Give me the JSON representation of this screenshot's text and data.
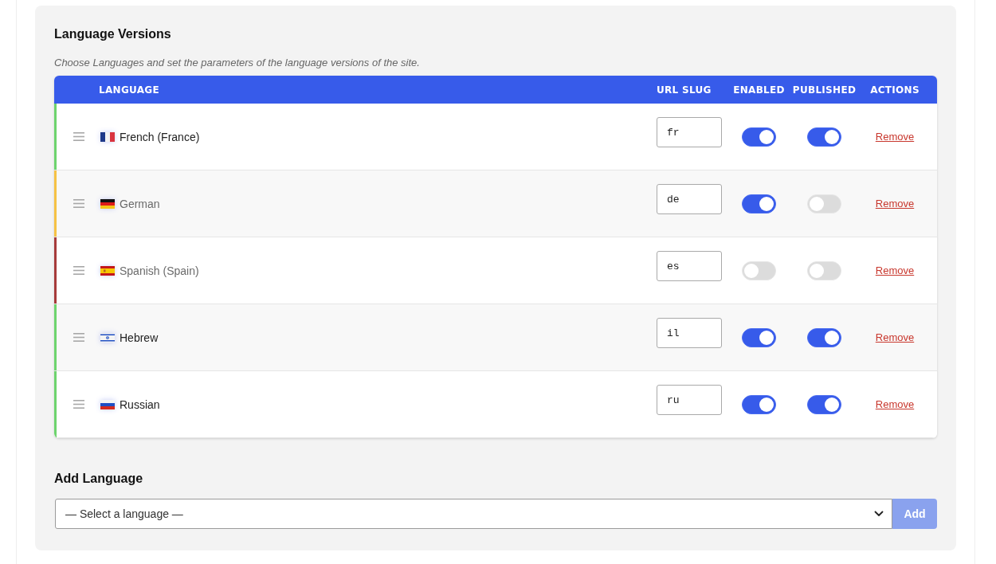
{
  "section": {
    "title": "Language Versions",
    "description": "Choose Languages and set the parameters of the language versions of the site."
  },
  "table": {
    "columns": [
      "LANGUAGE",
      "URL SLUG",
      "ENABLED",
      "PUBLISHED",
      "ACTIONS"
    ],
    "rows": [
      {
        "kind": "france",
        "language": "French (France)",
        "dimmed": false,
        "color": "#6dd46d",
        "url_slug": "fr",
        "enabled": true,
        "published": true,
        "action": "Remove"
      },
      {
        "kind": "germany",
        "language": "German",
        "dimmed": true,
        "color": "#f6c244",
        "url_slug": "de",
        "enabled": true,
        "published": false,
        "action": "Remove"
      },
      {
        "kind": "spain",
        "language": "Spanish (Spain)",
        "dimmed": true,
        "color": "#a63a3a",
        "url_slug": "es",
        "enabled": false,
        "published": false,
        "action": "Remove"
      },
      {
        "kind": "israel",
        "language": "Hebrew",
        "dimmed": false,
        "color": "#6dd46d",
        "url_slug": "il",
        "enabled": true,
        "published": true,
        "action": "Remove"
      },
      {
        "kind": "russia",
        "language": "Russian",
        "dimmed": false,
        "color": "#6dd46d",
        "url_slug": "ru",
        "enabled": true,
        "published": true,
        "action": "Remove"
      }
    ]
  },
  "add_language": {
    "title": "Add Language",
    "select": {
      "placeholder": "— Select a language —"
    },
    "add_button": {
      "label": "Add",
      "disabled": true
    }
  }
}
